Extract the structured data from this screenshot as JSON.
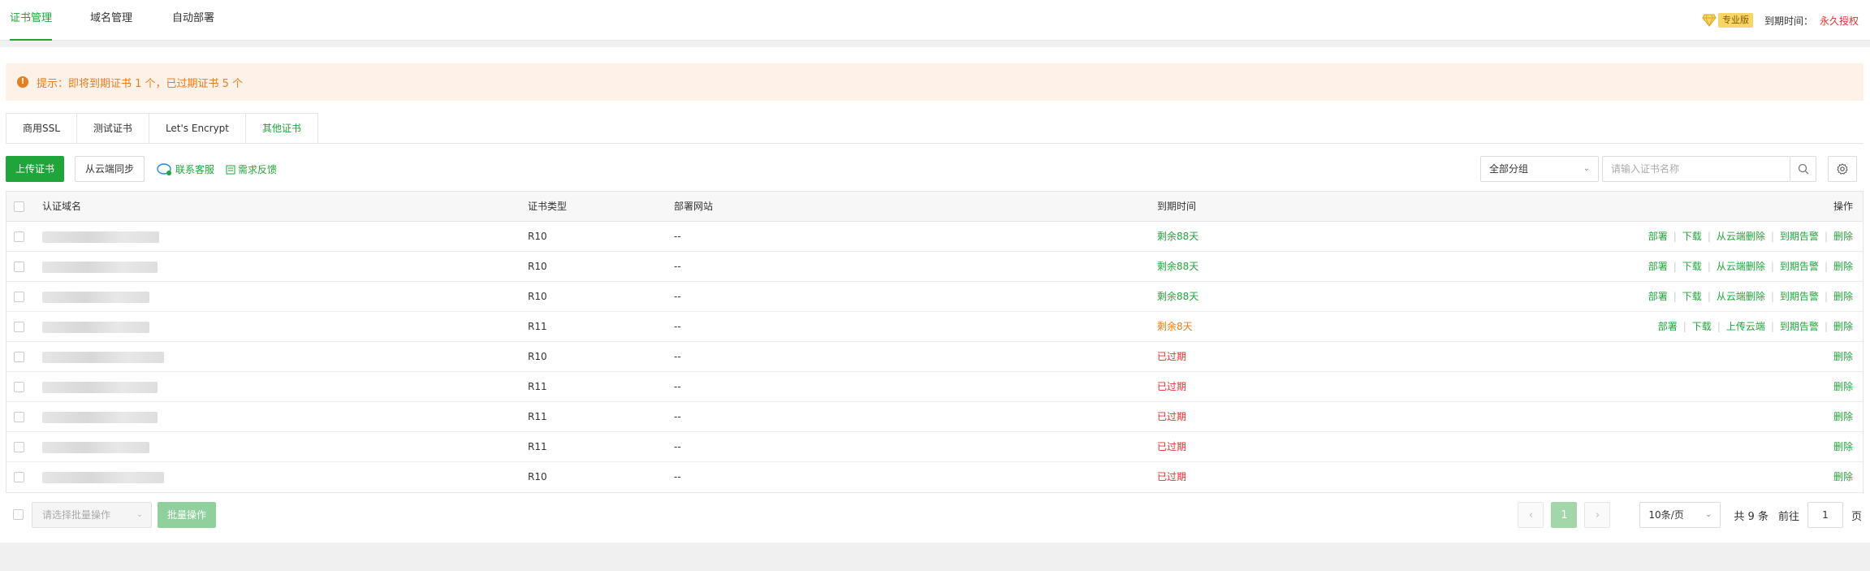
{
  "nav": {
    "tabs": [
      "证书管理",
      "域名管理",
      "自动部署"
    ],
    "active_tab": 0,
    "pro_badge": "专业版",
    "expire_label": "到期时间：",
    "expire_value": "永久授权"
  },
  "alert": {
    "text": "提示：即将到期证书 1 个，已过期证书 5 个"
  },
  "subtabs": [
    "商用SSL",
    "测试证书",
    "Let's Encrypt",
    "其他证书"
  ],
  "active_subtab": 3,
  "toolbar": {
    "upload_label": "上传证书",
    "sync_label": "从云端同步",
    "contact_label": "联系客服",
    "feedback_label": "需求反馈",
    "group_select": "全部分组",
    "search_placeholder": "请输入证书名称"
  },
  "table": {
    "headers": {
      "domain": "认证域名",
      "type": "证书类型",
      "site": "部署网站",
      "expire": "到期时间",
      "ops": "操作"
    },
    "rows": [
      {
        "type": "R10",
        "site": "--",
        "expire": "剩余88天",
        "status": "ok",
        "ops": [
          "部署",
          "下载",
          "从云端删除",
          "到期告警",
          "删除"
        ]
      },
      {
        "type": "R10",
        "site": "--",
        "expire": "剩余88天",
        "status": "ok",
        "ops": [
          "部署",
          "下载",
          "从云端删除",
          "到期告警",
          "删除"
        ]
      },
      {
        "type": "R10",
        "site": "--",
        "expire": "剩余88天",
        "status": "ok",
        "ops": [
          "部署",
          "下载",
          "从云端删除",
          "到期告警",
          "删除"
        ]
      },
      {
        "type": "R11",
        "site": "--",
        "expire": "剩余8天",
        "status": "warn",
        "ops": [
          "部署",
          "下载",
          "上传云端",
          "到期告警",
          "删除"
        ]
      },
      {
        "type": "R10",
        "site": "--",
        "expire": "已过期",
        "status": "expired",
        "ops": [
          "删除"
        ]
      },
      {
        "type": "R11",
        "site": "--",
        "expire": "已过期",
        "status": "expired",
        "ops": [
          "删除"
        ]
      },
      {
        "type": "R11",
        "site": "--",
        "expire": "已过期",
        "status": "expired",
        "ops": [
          "删除"
        ]
      },
      {
        "type": "R11",
        "site": "--",
        "expire": "已过期",
        "status": "expired",
        "ops": [
          "删除"
        ]
      },
      {
        "type": "R10",
        "site": "--",
        "expire": "已过期",
        "status": "expired",
        "ops": [
          "删除"
        ]
      }
    ]
  },
  "footer": {
    "batch_placeholder": "请选择批量操作",
    "batch_button": "批量操作",
    "current_page": "1",
    "page_size": "10条/页",
    "total": "共 9 条",
    "goto_label": "前往",
    "goto_value": "1",
    "page_unit": "页"
  },
  "colors": {
    "accent": "#20a53a",
    "warning": "#e67e22",
    "danger": "#e6302f"
  }
}
